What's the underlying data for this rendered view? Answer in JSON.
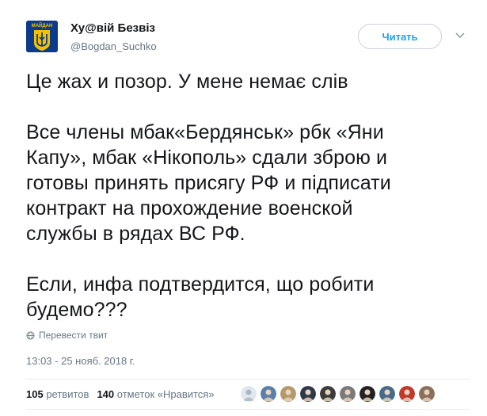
{
  "author": {
    "display_name": "Ху@вій Безвіз",
    "handle": "@Bogdan_Suchko",
    "avatar_text": "МАЙДАН"
  },
  "follow_button": {
    "label": "Читать"
  },
  "tweet": {
    "paragraph1": [
      "Це жах и позор. У мене немає слів"
    ],
    "paragraph2": [
      "Все члены мбак«Бердянськ» рбк «Яни",
      "Капу», мбак «Нікополь» сдали зброю и",
      "готовы принять присягу РФ и підписати",
      "контракт на прохождение военской",
      "службы в рядах ВС РФ."
    ],
    "paragraph3": [
      "Если, инфа подтвердится, що робити",
      "будемо???"
    ]
  },
  "translate": {
    "label": "Перевести твит",
    "icon": "globe-icon"
  },
  "timestamp": "13:03 - 25 нояб. 2018 г.",
  "stats": {
    "retweets_count": "105",
    "retweets_label": "ретвитов",
    "likes_count": "140",
    "likes_label": "отметок «Нравится»"
  },
  "likers": [
    {
      "icon": "default-avatar",
      "color": "#aab8c2"
    },
    {
      "icon": "liker-avatar",
      "color": "#5b7fa8"
    },
    {
      "icon": "liker-avatar",
      "color": "#b49a6a"
    },
    {
      "icon": "liker-avatar",
      "color": "#2e3a4a"
    },
    {
      "icon": "liker-avatar",
      "color": "#3c3c3c"
    },
    {
      "icon": "liker-avatar",
      "color": "#7a7a7a"
    },
    {
      "icon": "liker-avatar",
      "color": "#222222"
    },
    {
      "icon": "liker-avatar",
      "color": "#4a6a8a"
    },
    {
      "icon": "liker-avatar",
      "color": "#c0392b"
    },
    {
      "icon": "liker-avatar",
      "color": "#8a6f5a"
    }
  ],
  "colors": {
    "accent": "#1da1f2",
    "secondary_text": "#657786",
    "avatar_bg": "#0d3b8c",
    "avatar_emblem": "#f2c200"
  }
}
